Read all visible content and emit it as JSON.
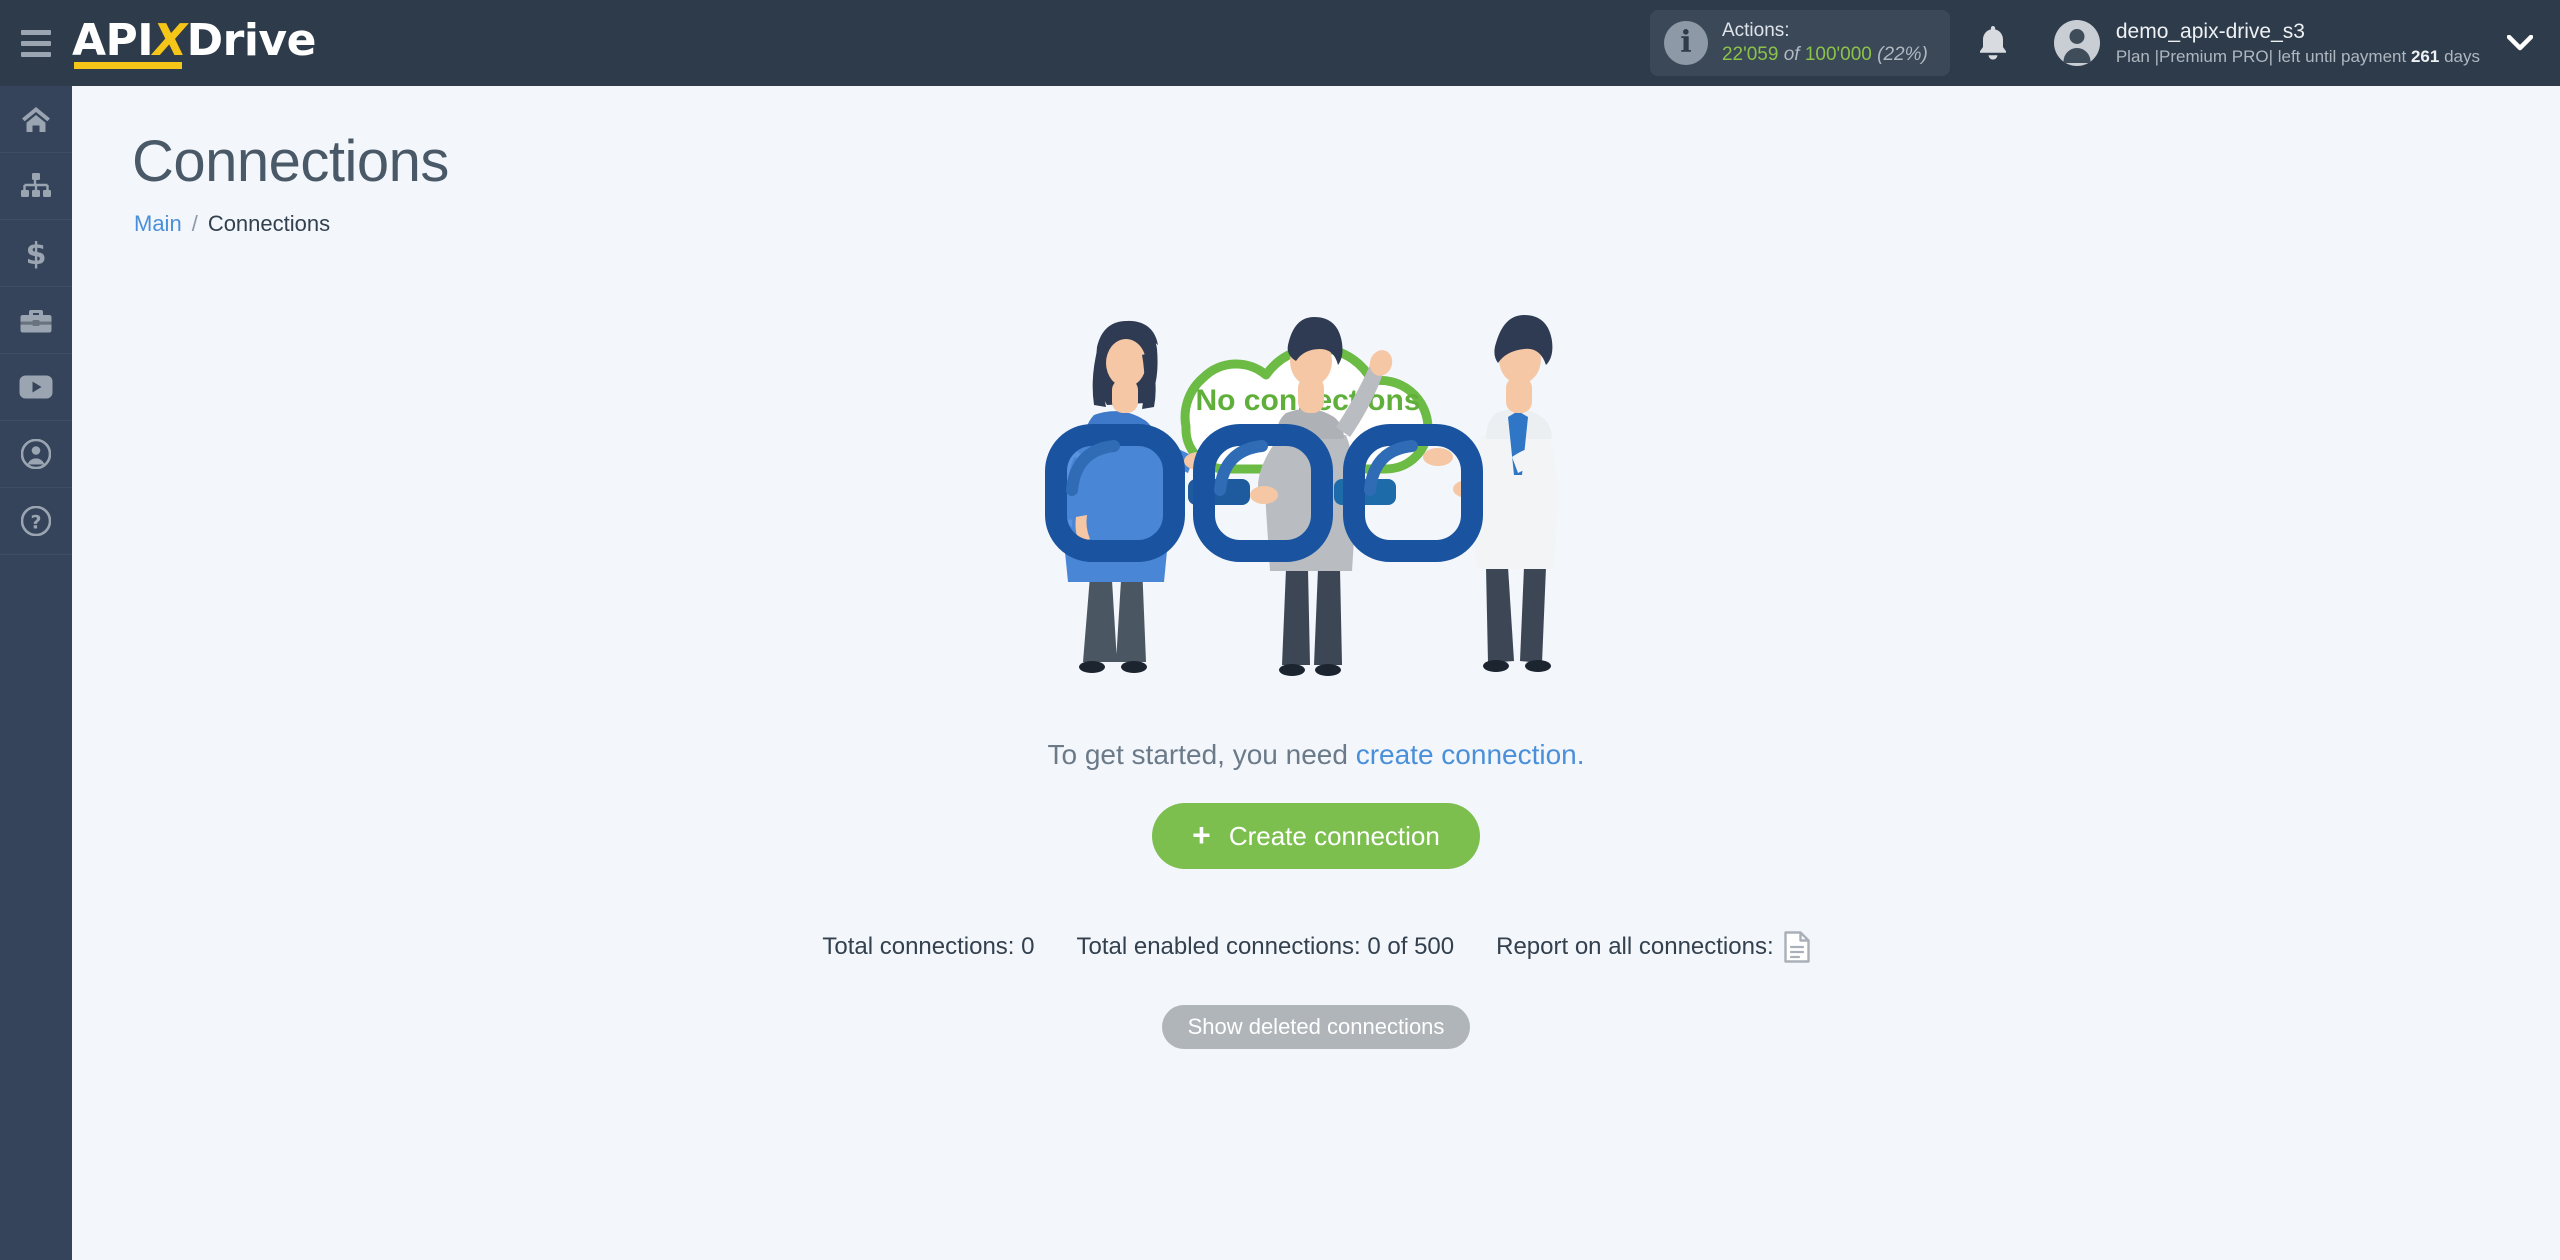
{
  "brand": {
    "name_part1": "API",
    "name_x": "X",
    "name_part2": "Drive"
  },
  "header": {
    "menu_icon": "hamburger-icon",
    "actions": {
      "label": "Actions:",
      "used": "22'059",
      "of": "of",
      "total": "100'000",
      "percent": "(22%)",
      "info_icon": "info-icon"
    },
    "notifications_icon": "bell-icon",
    "account": {
      "name": "demo_apix-drive_s3",
      "plan_prefix": "Plan |Premium PRO| left until payment",
      "days_value": "261",
      "days_suffix": "days",
      "avatar_icon": "avatar-icon",
      "chevron_icon": "chevron-down-icon"
    }
  },
  "sidebar": {
    "items": [
      {
        "icon": "home-icon",
        "name": "sidebar-item-home"
      },
      {
        "icon": "sitemap-icon",
        "name": "sidebar-item-connections"
      },
      {
        "icon": "dollar-icon",
        "name": "sidebar-item-billing"
      },
      {
        "icon": "briefcase-icon",
        "name": "sidebar-item-business"
      },
      {
        "icon": "youtube-icon",
        "name": "sidebar-item-video"
      },
      {
        "icon": "user-icon",
        "name": "sidebar-item-profile"
      },
      {
        "icon": "help-icon",
        "name": "sidebar-item-help"
      }
    ]
  },
  "page": {
    "title": "Connections",
    "breadcrumb": {
      "root": "Main",
      "separator": "/",
      "current": "Connections"
    }
  },
  "empty_state": {
    "cloud_label": "No connections",
    "cta_text_before": "To get started, you need ",
    "cta_link": "create connection.",
    "create_button": {
      "plus": "+",
      "label": "Create connection"
    }
  },
  "stats": {
    "total_connections": "Total connections: 0",
    "total_enabled": "Total enabled connections: 0 of 500",
    "report_label": "Report on all connections:",
    "report_icon": "document-icon"
  },
  "footer_actions": {
    "show_deleted": "Show deleted connections"
  },
  "colors": {
    "header_bg": "#2e3b4a",
    "sidebar_bg": "#35445a",
    "page_bg": "#f3f6fb",
    "accent_green": "#7cbf4f",
    "accent_blue": "#4a90d9",
    "brand_yellow": "#f5c518",
    "chain_blue": "#1f5da8",
    "grey_button": "#b0b5ba"
  }
}
